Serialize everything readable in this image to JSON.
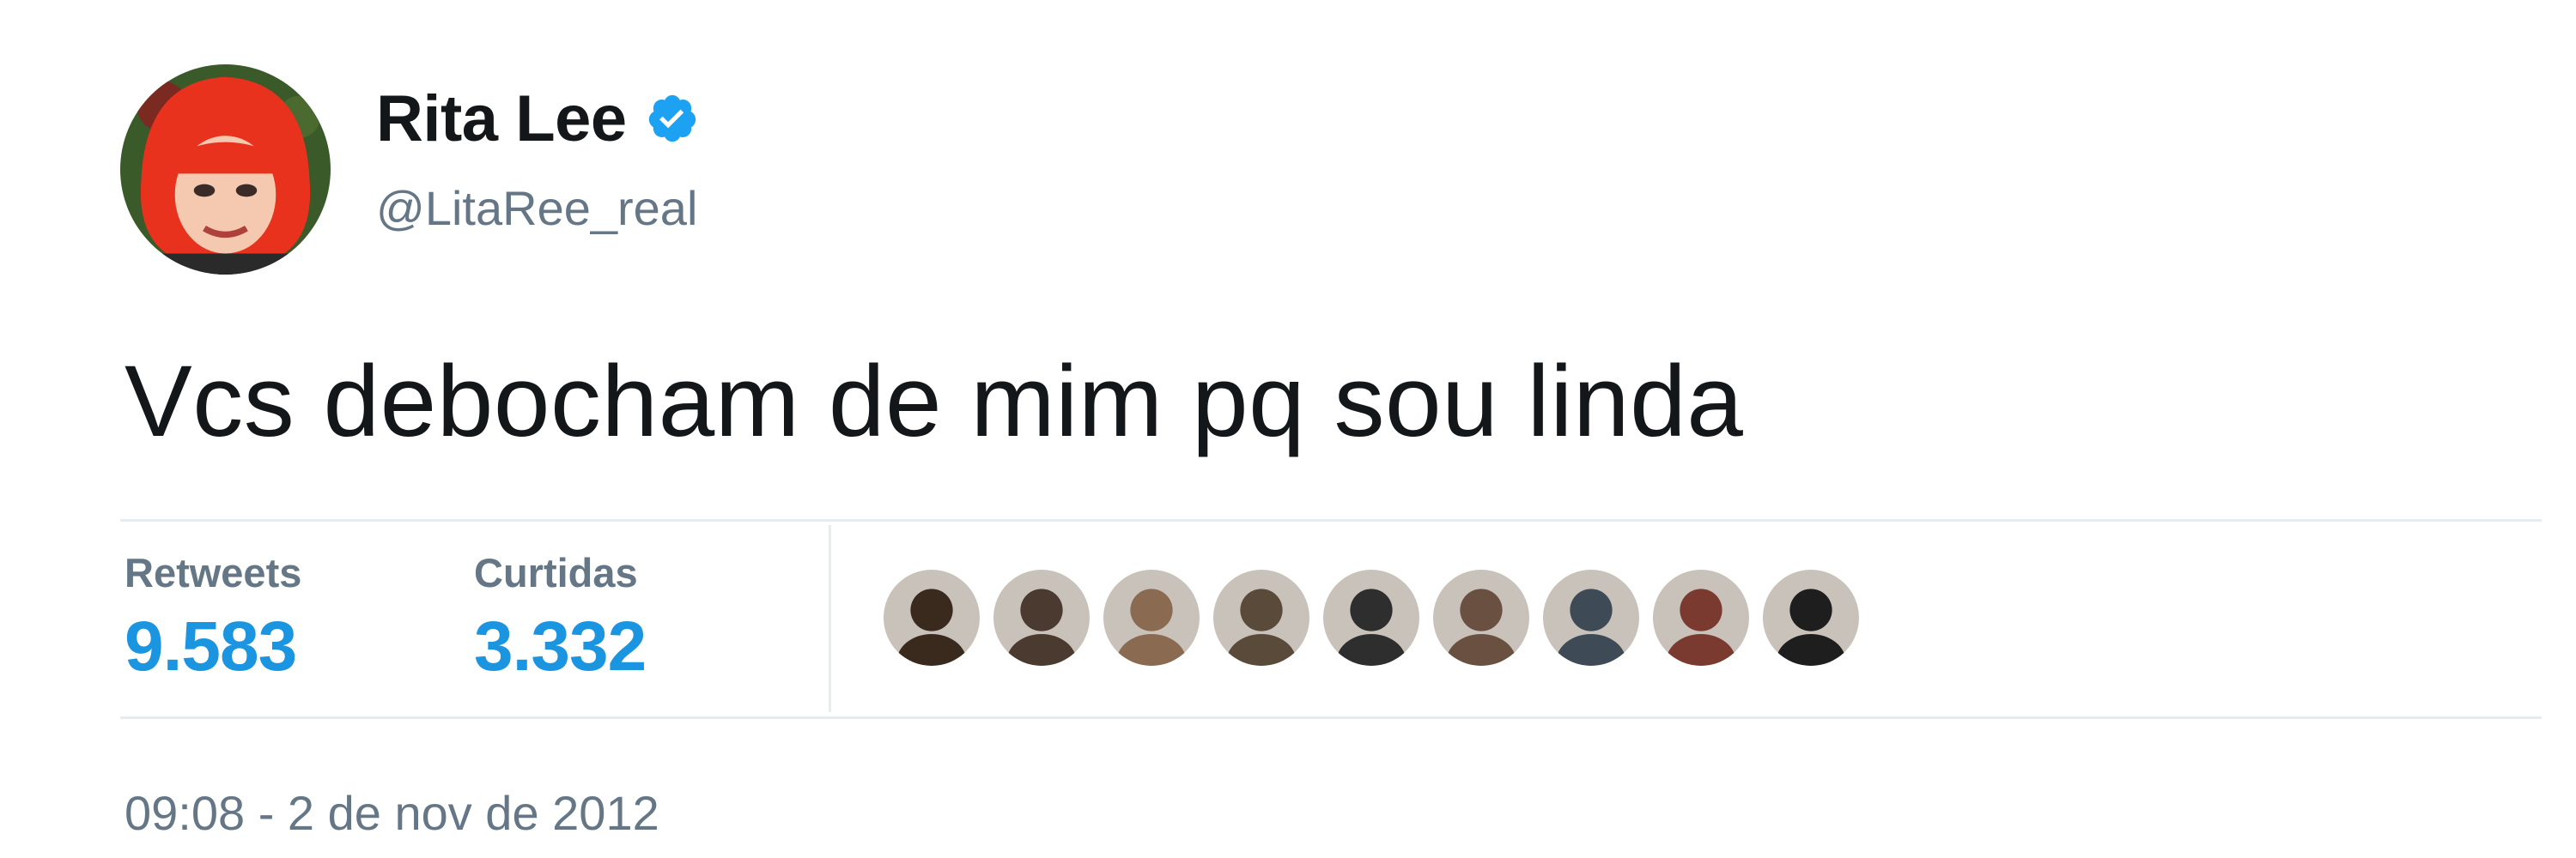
{
  "tweet": {
    "display_name": "Rita Lee",
    "handle": "@LitaRee_real",
    "verified": true,
    "text": "Vcs debocham de mim pq sou linda",
    "timestamp": "09:08 - 2 de nov de 2012"
  },
  "stats": {
    "retweets_label": "Retweets",
    "retweets_value": "9.583",
    "likes_label": "Curtidas",
    "likes_value": "3.332"
  },
  "likers": [
    {
      "icon": "avatar-icon",
      "color": "#3a2a1e"
    },
    {
      "icon": "avatar-icon",
      "color": "#4a3a30"
    },
    {
      "icon": "avatar-icon",
      "color": "#8a6a50"
    },
    {
      "icon": "avatar-icon",
      "color": "#5a4a3a"
    },
    {
      "icon": "avatar-icon",
      "color": "#2e2e2e"
    },
    {
      "icon": "avatar-icon",
      "color": "#6a5040"
    },
    {
      "icon": "avatar-icon",
      "color": "#3e4a55"
    },
    {
      "icon": "avatar-icon",
      "color": "#7a3a30"
    },
    {
      "icon": "avatar-icon",
      "color": "#1e1e1e"
    }
  ],
  "colors": {
    "accent": "#1b95e0",
    "verified": "#1da1f2",
    "text": "#14171a",
    "muted": "#657786"
  }
}
